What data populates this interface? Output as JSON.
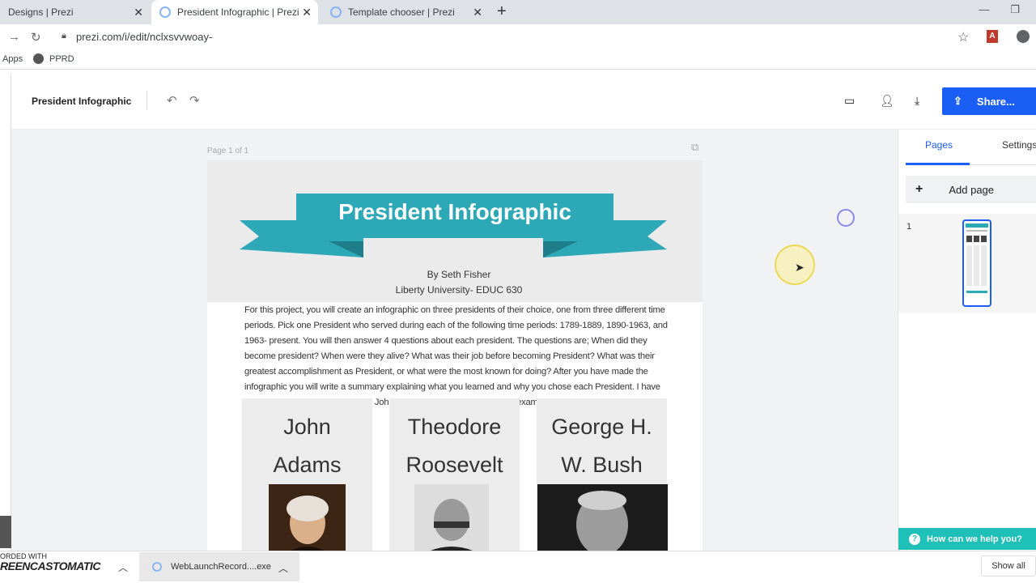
{
  "browser": {
    "tabs": [
      {
        "title": "Designs | Prezi",
        "active": false
      },
      {
        "title": "President Infographic | Prezi Des",
        "active": true
      },
      {
        "title": "Template chooser | Prezi",
        "active": false
      }
    ],
    "new_tab": "+",
    "url": "prezi.com/i/edit/nclxsvvwoay-",
    "bookmarks": [
      {
        "label": "Apps"
      },
      {
        "label": "PPRD"
      }
    ],
    "icons": {
      "back": "arrow-right-icon",
      "reload": "reload-icon",
      "lock": "lock-icon",
      "star": "star-icon"
    }
  },
  "app": {
    "title": "President Infographic",
    "undo": "↶",
    "redo": "↷",
    "share_label": "Share...",
    "accent": "#1a5ef5"
  },
  "canvas": {
    "page_label": "Page 1 of 1",
    "banner_title": "President Infographic",
    "banner_color": "#2da8b7",
    "byline": "By Seth Fisher",
    "university": "Liberty University- EDUC 630",
    "assignment": "For this project, you will create an infographic on three presidents of their choice, one from three different time periods. Pick one President who served during each of the following time periods: 1789-1889, 1890-1963, and 1963- present. You will then answer 4 questions about each president. The questions are; When did they become president? When were they alive? What was their job before becoming President? What was their greatest accomplishment as President, or what were the most known for doing? After you have made the infographic you will write a summary explaining what you learned and why you chose each President. I have attached an example.  Do not use John Adams since I used him as the example.",
    "presidents": [
      {
        "name_line1": "John",
        "name_line2": "Adams"
      },
      {
        "name_line1": "Theodore",
        "name_line2": "Roosevelt"
      },
      {
        "name_line1": "George H.",
        "name_line2": "W. Bush"
      }
    ]
  },
  "right_panel": {
    "tabs": [
      "Pages",
      "Settings"
    ],
    "add_page": "Add page",
    "page_number": "1"
  },
  "help": {
    "label": "How can we help you?"
  },
  "downloads": {
    "recorder_line1": "ORDED WITH",
    "recorder_brand": "REENCASTOMATIC",
    "file": "WebLaunchRecord....exe",
    "show_all": "Show all"
  }
}
